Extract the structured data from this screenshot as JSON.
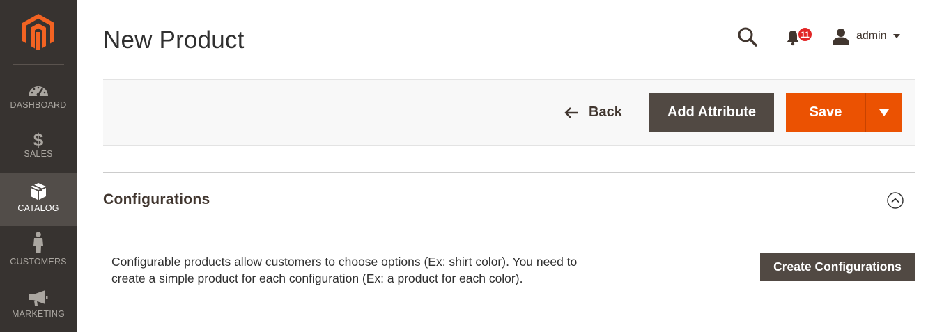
{
  "sidebar": {
    "logo_icon": "magento-logo",
    "items": [
      {
        "label": "DASHBOARD",
        "icon": "dashboard-gauge-icon",
        "active": false
      },
      {
        "label": "SALES",
        "icon": "dollar-icon",
        "active": false
      },
      {
        "label": "CATALOG",
        "icon": "box-icon",
        "active": true
      },
      {
        "label": "CUSTOMERS",
        "icon": "person-icon",
        "active": false
      },
      {
        "label": "MARKETING",
        "icon": "megaphone-icon",
        "active": false
      }
    ]
  },
  "header": {
    "title": "New Product",
    "search_icon": "search-icon",
    "notifications": {
      "icon": "bell-icon",
      "count": "11"
    },
    "user": {
      "name": "admin",
      "icon": "user-icon"
    }
  },
  "actions": {
    "back_label": "Back",
    "add_attribute_label": "Add Attribute",
    "save_label": "Save"
  },
  "configurations": {
    "title": "Configurations",
    "description": "Configurable products allow customers to choose options (Ex: shirt color). You need to create a simple product for each configuration (Ex: a product for each color).",
    "create_button_label": "Create Configurations"
  },
  "colors": {
    "sidebar_bg": "#373330",
    "sidebar_active": "#524d49",
    "brand_orange": "#eb5202",
    "button_dark": "#514943",
    "badge_red": "#e22626"
  }
}
